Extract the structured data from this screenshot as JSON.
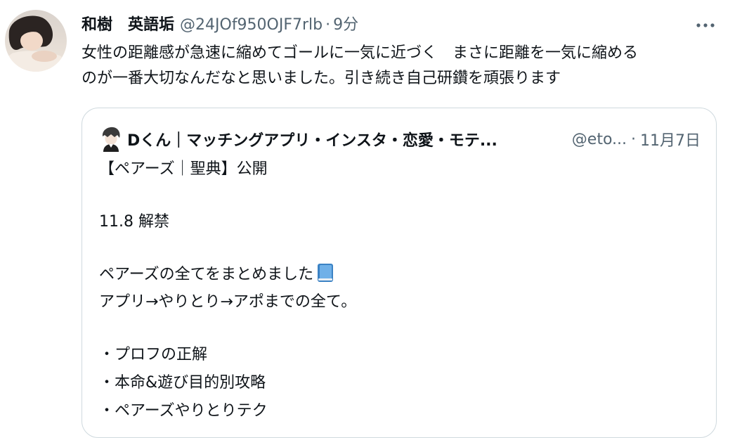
{
  "tweet": {
    "author_name": "和樹　英語垢",
    "author_handle": "@24JOf950OJF7rlb",
    "dot": "·",
    "time": "9分",
    "more_label": "•••",
    "text_lines": [
      "女性の距離感が急速に縮めてゴールに一気に近づく　まさに距離を一気に縮める",
      "のが一番大切なんだなと思いました。引き続き自己研鑽を頑張ります"
    ]
  },
  "quote": {
    "author_name": "Dくん｜マッチングアプリ・インスタ・恋愛・モテ...",
    "author_handle": "@eto...",
    "dot": "·",
    "date": "11月7日",
    "lines": [
      "【ペアーズ｜聖典】公開",
      "11.8 解禁",
      "ペアーズの全てをまとめました",
      "アプリ→やりとり→アポまでの全て。",
      "・プロフの正解",
      "・本命&遊び目的別攻略",
      "・ペアーズやりとりテク"
    ],
    "book_icon": "blue-book-icon"
  },
  "colors": {
    "text": "#0f1419",
    "secondary": "#536471",
    "border": "#cfd9de",
    "book": "#3b82c4"
  }
}
